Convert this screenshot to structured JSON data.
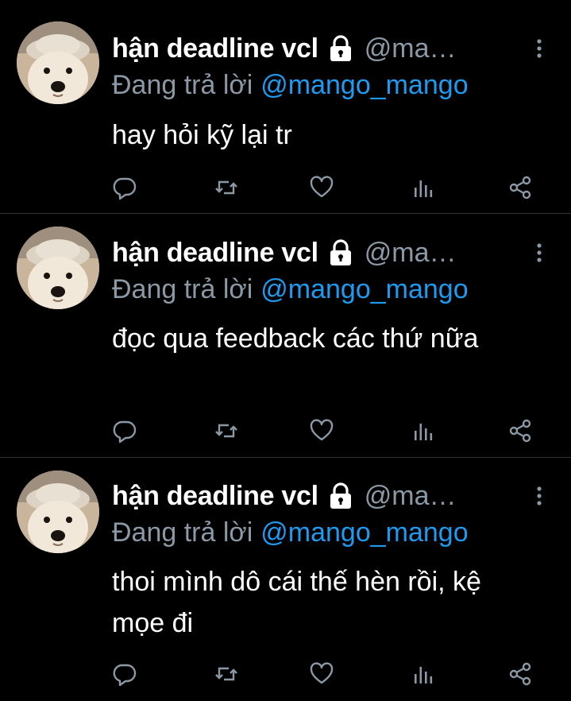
{
  "colors": {
    "background": "#000000",
    "text": "#ffffff",
    "muted": "#8b98a5",
    "mention": "#1d9bf0",
    "divider": "#2f3336"
  },
  "tweets": [
    {
      "display_name": "hận deadline vcl",
      "handle": "@ma…",
      "reply_prefix": "Đang trả lời",
      "reply_to": "@mango_mango",
      "text": "hay hỏi kỹ lại tr",
      "avatar_icon": "dog-avatar",
      "badge_icon": "lock-icon"
    },
    {
      "display_name": "hận deadline vcl",
      "handle": "@ma…",
      "reply_prefix": "Đang trả lời",
      "reply_to": "@mango_mango",
      "text": "đọc qua feedback các thứ nữa",
      "avatar_icon": "dog-avatar",
      "badge_icon": "lock-icon"
    },
    {
      "display_name": "hận deadline vcl",
      "handle": "@ma…",
      "reply_prefix": "Đang trả lời",
      "reply_to": "@mango_mango",
      "text": "thoi mình dô cái thế hèn rồi, kệ mọe đi",
      "avatar_icon": "dog-avatar",
      "badge_icon": "lock-icon"
    }
  ],
  "action_icons": [
    "reply-icon",
    "retweet-icon",
    "like-icon",
    "analytics-icon",
    "share-icon"
  ]
}
